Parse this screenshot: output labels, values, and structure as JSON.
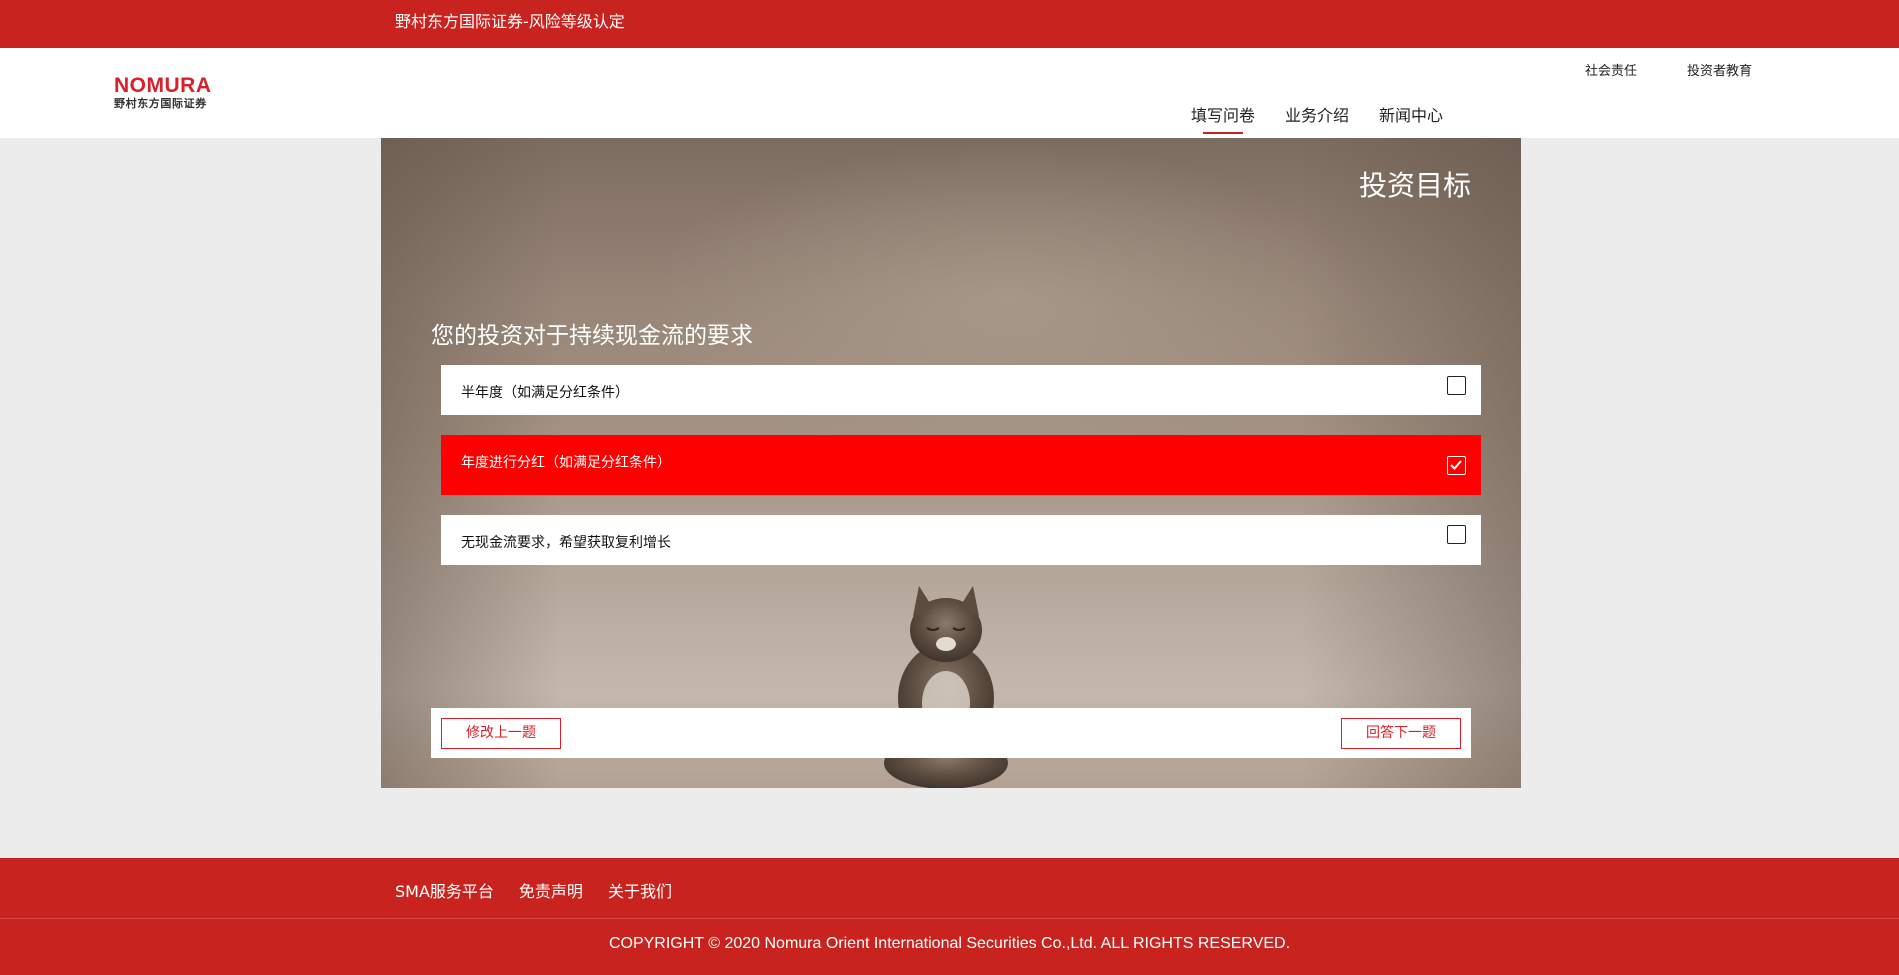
{
  "topbar": {
    "title": "野村东方国际证券-风险等级认定"
  },
  "header": {
    "logo_text": "NOMURA",
    "logo_subtext": "野村东方国际证券",
    "util_links": [
      "社会责任",
      "投资者教育"
    ],
    "nav": [
      {
        "label": "填写问卷",
        "active": true
      },
      {
        "label": "业务介绍",
        "active": false
      },
      {
        "label": "新闻中心",
        "active": false
      }
    ]
  },
  "survey": {
    "section_title": "投资目标",
    "question": "您的投资对于持续现金流的要求",
    "options": [
      {
        "label": "半年度（如满足分红条件）",
        "selected": false
      },
      {
        "label": "年度进行分红（如满足分红条件）",
        "selected": true
      },
      {
        "label": "无现金流要求，希望获取复利增长",
        "selected": false
      }
    ],
    "prev_label": "修改上一题",
    "next_label": "回答下一题"
  },
  "footer": {
    "links": [
      "SMA服务平台",
      "免责声明",
      "关于我们"
    ],
    "copyright": "COPYRIGHT © 2020 Nomura Orient International Securities Co.,Ltd. ALL RIGHTS RESERVED."
  },
  "colors": {
    "brand_red": "#c9231f",
    "selected_red": "#ff0000",
    "page_bg": "#ececec"
  }
}
